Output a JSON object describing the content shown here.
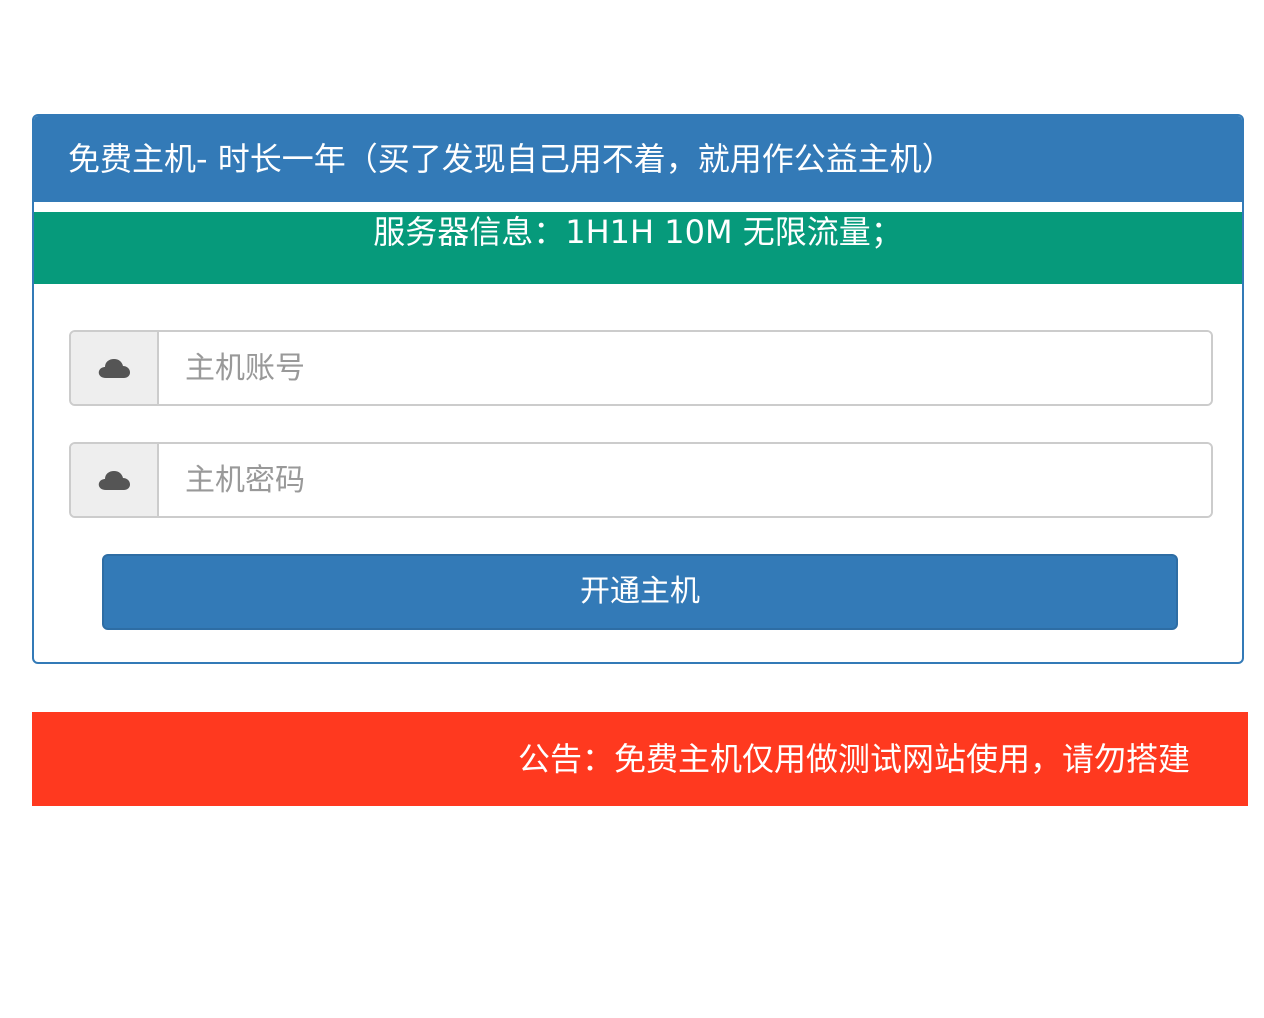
{
  "panel": {
    "title": "免费主机- 时长一年（买了发现自己用不着，就用作公益主机）",
    "server_info": "服务器信息：1H1H 10M 无限流量；"
  },
  "form": {
    "account": {
      "icon": "cloud-icon",
      "placeholder": "主机账号",
      "value": ""
    },
    "password": {
      "icon": "cloud-icon",
      "placeholder": "主机密码",
      "value": ""
    },
    "submit_label": "开通主机"
  },
  "notice": {
    "text": "公告：免费主机仅用做测试网站使用，请勿搭建"
  },
  "colors": {
    "primary": "#337ab7",
    "info_bar": "#069a7b",
    "notice_bar": "#ff391f"
  }
}
